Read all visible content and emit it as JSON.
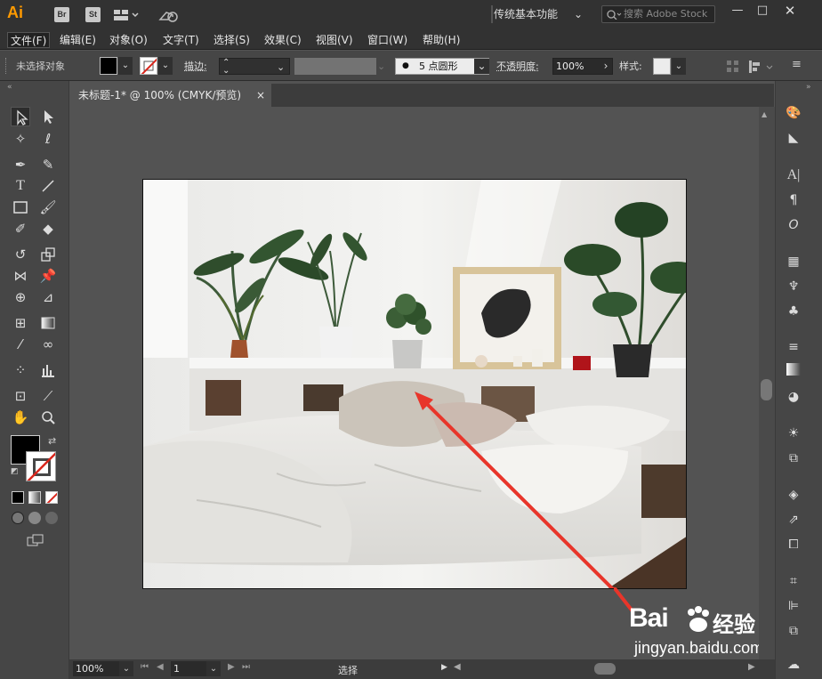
{
  "app": {
    "logo": "Ai"
  },
  "bridge": {
    "br": "Br",
    "st": "St"
  },
  "workspace": {
    "label": "传统基本功能"
  },
  "search": {
    "placeholder": "搜索 Adobe Stock"
  },
  "menus": [
    "文件(F)",
    "编辑(E)",
    "对象(O)",
    "文字(T)",
    "选择(S)",
    "效果(C)",
    "视图(V)",
    "窗口(W)",
    "帮助(H)"
  ],
  "control": {
    "selection_status": "未选择对象",
    "stroke_label": "描边",
    "brush_dot": "●",
    "brush_label": "5 点圆形",
    "opacity_label": "不透明度",
    "opacity_value": "100%",
    "style_label": "样式"
  },
  "document": {
    "tab_title": "未标题-1* @ 100% (CMYK/预览)",
    "close": "×"
  },
  "status": {
    "zoom": "100%",
    "page": "1",
    "mode": "选择"
  },
  "watermark": {
    "brand": "Bai",
    "brand2": "经验",
    "url": "jingyan.baidu.com"
  },
  "colors": {
    "accent_orange": "#ff9a00",
    "arrow_red": "#e8352a",
    "fill_black": "#000000",
    "stroke_none_red": "#d9261c"
  }
}
